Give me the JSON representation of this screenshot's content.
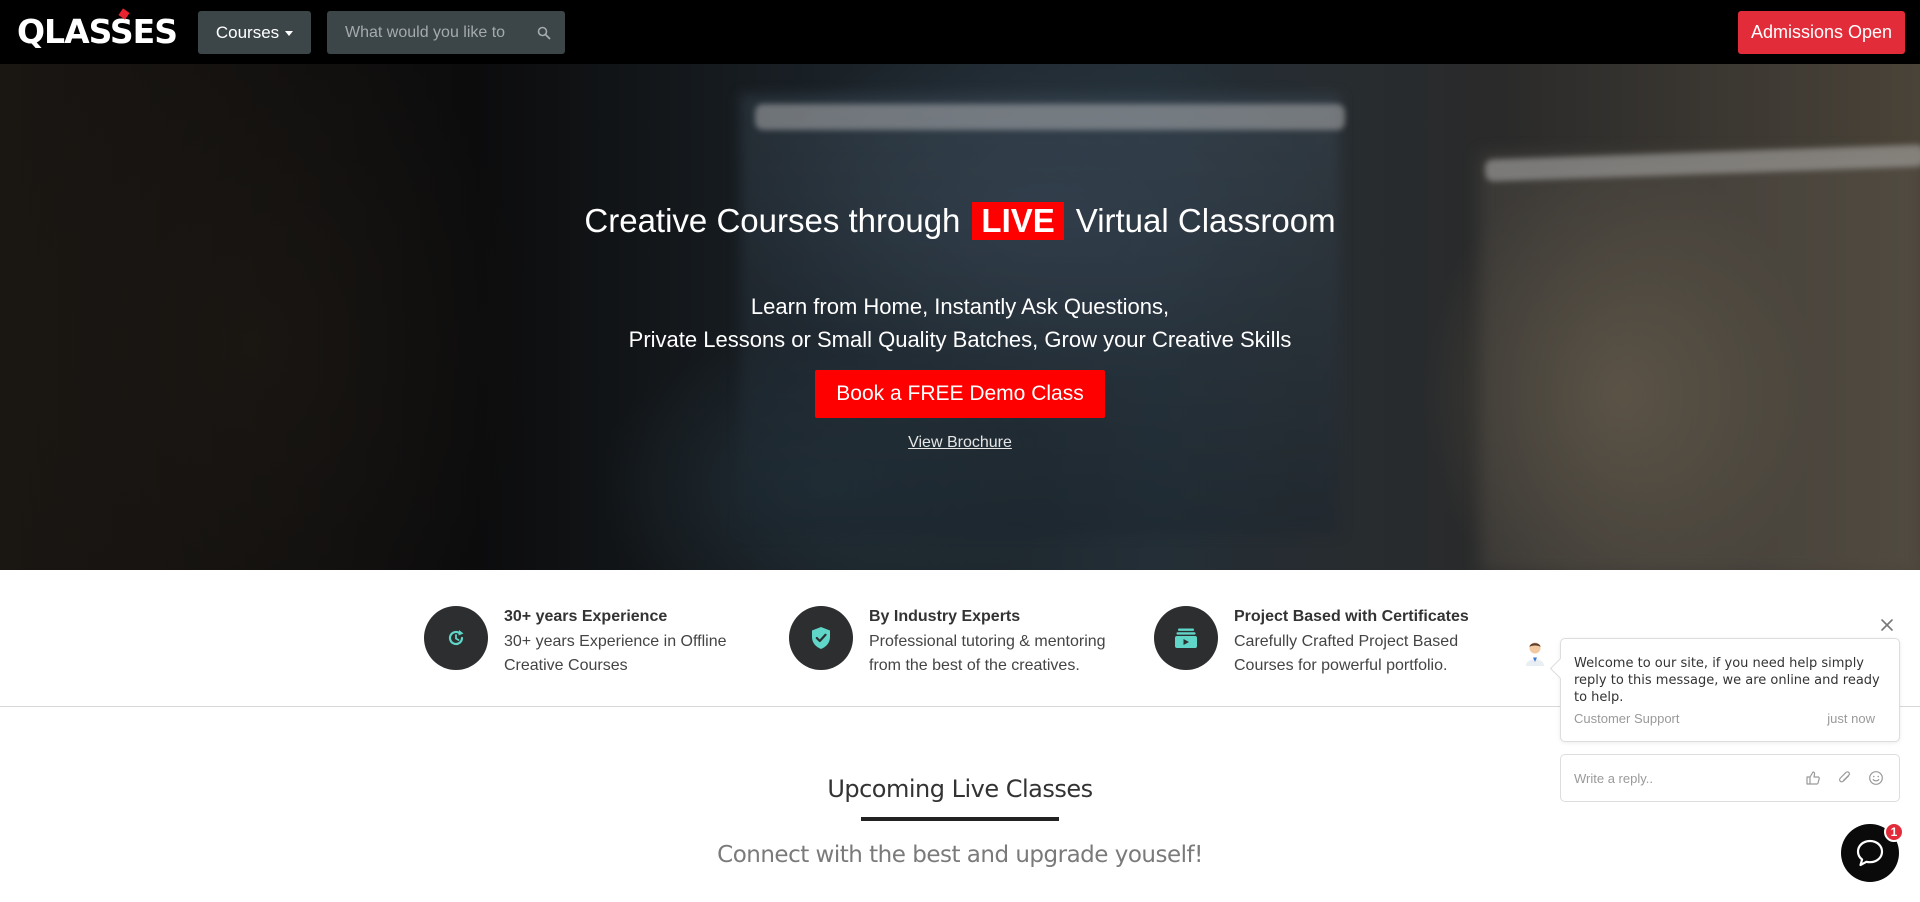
{
  "navbar": {
    "logo_text": "QLASSES",
    "courses_label": "Courses",
    "search_placeholder": "What would you like to",
    "admissions_label": "Admissions Open"
  },
  "hero": {
    "title_before": "Creative Courses through",
    "title_badge": "LIVE",
    "title_after": "Virtual Classroom",
    "subtitle_line1": "Learn from Home, Instantly Ask Questions,",
    "subtitle_line2": "Private Lessons or Small Quality Batches, Grow your Creative Skills",
    "cta_label": "Book a FREE Demo Class",
    "brochure_label": "View Brochure"
  },
  "features": [
    {
      "icon": "refresh-icon",
      "title": "30+ years Experience",
      "desc_line1": "30+ years Experience in Offline",
      "desc_line2": "Creative Courses"
    },
    {
      "icon": "shield-check-icon",
      "title": "By Industry Experts",
      "desc_line1": "Professional tutoring & mentoring",
      "desc_line2": "from the best of the creatives."
    },
    {
      "icon": "certificate-box-icon",
      "title": "Project Based with Certificates",
      "desc_line1": "Carefully Crafted Project Based",
      "desc_line2": "Courses for powerful portfolio."
    }
  ],
  "upcoming": {
    "title": "Upcoming Live Classes",
    "subtitle": "Connect with the best and upgrade youself!"
  },
  "chat": {
    "message": "Welcome to our site, if you need help simply reply to this message, we are online and ready to help.",
    "sender": "Customer Support",
    "time": "just now",
    "reply_placeholder": "Write a reply..",
    "unread_count": "1"
  },
  "colors": {
    "accent_red": "#e32c3a",
    "live_red": "#ff0000",
    "nav_bg": "#000000",
    "nav_control_bg": "#3c4649",
    "feature_icon_bg": "#2c2e2f",
    "feature_icon_fg": "#5fd6c8"
  }
}
